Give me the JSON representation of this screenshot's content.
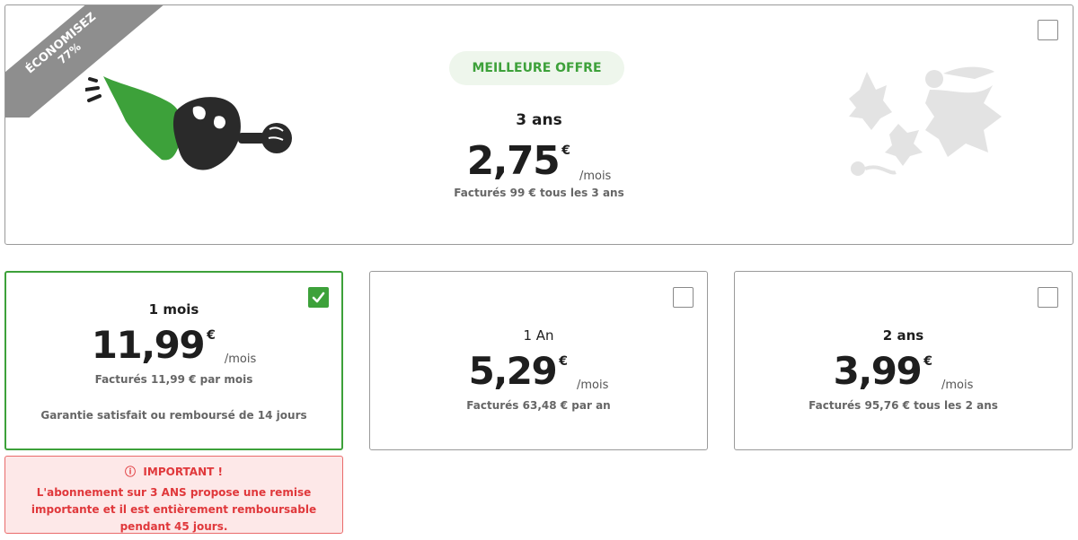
{
  "featured": {
    "ribbon_line1": "ÉCONOMISEZ",
    "ribbon_line2": "77%",
    "badge": "MEILLEURE OFFRE",
    "duration": "3 ans",
    "price": "2,75",
    "currency": "€",
    "per": "/mois",
    "billing": "Facturés 99 € tous les 3 ans",
    "selected": false
  },
  "plans": [
    {
      "duration": "1 mois",
      "price": "11,99",
      "currency": "€",
      "per": "/mois",
      "billing": "Facturés 11,99 € par mois",
      "guarantee": "Garantie satisfait ou remboursé de 14 jours",
      "selected": true
    },
    {
      "duration": "1 An",
      "price": "5,29",
      "currency": "€",
      "per": "/mois",
      "billing": "Facturés 63,48 € par an",
      "selected": false
    },
    {
      "duration": "2 ans",
      "price": "3,99",
      "currency": "€",
      "per": "/mois",
      "billing": "Facturés 95,76 € tous les 2 ans",
      "selected": false
    }
  ],
  "warning": {
    "icon": "ⓘ",
    "title": "IMPORTANT !",
    "body": "L'abonnement sur 3 ANS propose une remise importante et il est entièrement remboursable pendant 45 jours."
  },
  "colors": {
    "accent_green": "#3da13a",
    "ribbon_gray": "#8e8e8e",
    "warning_red": "#e0383b",
    "warning_bg": "#fde8e8"
  },
  "icons": {
    "hero": "masked-hero-illustration",
    "monsters": "virus-monsters-illustration",
    "check": "check-icon",
    "info": "info-icon"
  }
}
